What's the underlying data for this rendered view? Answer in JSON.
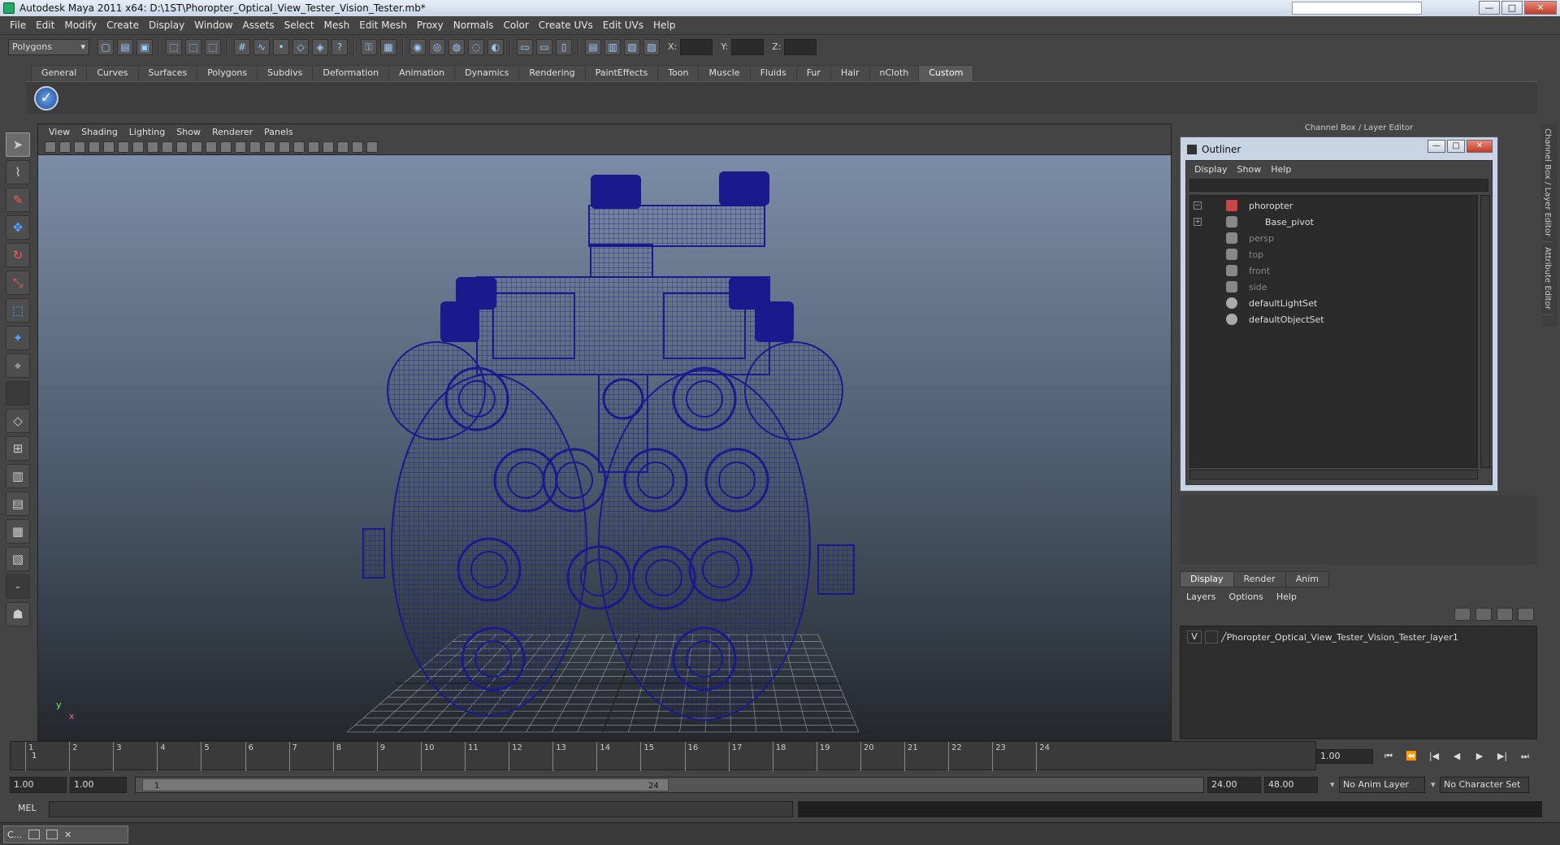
{
  "window": {
    "title": "Autodesk Maya 2011 x64: D:\\1ST\\Phoropter_Optical_View_Tester_Vision_Tester.mb*",
    "minimize": "—",
    "maximize": "□",
    "close": "✕"
  },
  "menubar": [
    "File",
    "Edit",
    "Modify",
    "Create",
    "Display",
    "Window",
    "Assets",
    "Select",
    "Mesh",
    "Edit Mesh",
    "Proxy",
    "Normals",
    "Color",
    "Create UVs",
    "Edit UVs",
    "Help"
  ],
  "statusline": {
    "mode": "Polygons",
    "x_label": "X:",
    "y_label": "Y:",
    "z_label": "Z:"
  },
  "shelf": {
    "tabs": [
      "General",
      "Curves",
      "Surfaces",
      "Polygons",
      "Subdivs",
      "Deformation",
      "Animation",
      "Dynamics",
      "Rendering",
      "PaintEffects",
      "Toon",
      "Muscle",
      "Fluids",
      "Fur",
      "Hair",
      "nCloth",
      "Custom"
    ],
    "active_tab": "Custom",
    "check_glyph": "✓"
  },
  "viewport": {
    "menu": [
      "View",
      "Shading",
      "Lighting",
      "Show",
      "Renderer",
      "Panels"
    ],
    "axis_y": "y",
    "axis_x": "x",
    "wire_color": "#1a1a8c"
  },
  "channel_box_title": "Channel Box / Layer Editor",
  "sidebar_tabs": [
    "Channel Box / Layer Editor",
    "Attribute Editor"
  ],
  "outliner": {
    "title": "Outliner",
    "menu": [
      "Display",
      "Show",
      "Help"
    ],
    "items": [
      {
        "label": "phoropter",
        "expander": "−",
        "type": "transform",
        "dim": false
      },
      {
        "label": "Base_pivot",
        "expander": "+",
        "type": "locator",
        "dim": false
      },
      {
        "label": "persp",
        "type": "camera",
        "dim": true
      },
      {
        "label": "top",
        "type": "camera",
        "dim": true
      },
      {
        "label": "front",
        "type": "camera",
        "dim": true
      },
      {
        "label": "side",
        "type": "camera",
        "dim": true
      },
      {
        "label": "defaultLightSet",
        "type": "set",
        "dim": false
      },
      {
        "label": "defaultObjectSet",
        "type": "set",
        "dim": false
      }
    ]
  },
  "layer_editor": {
    "tabs": [
      "Display",
      "Render",
      "Anim"
    ],
    "active_tab": "Display",
    "menu": [
      "Layers",
      "Options",
      "Help"
    ],
    "layer": {
      "visible": "V",
      "name": "Phoropter_Optical_View_Tester_Vision_Tester_layer1"
    }
  },
  "timeline": {
    "ticks": [
      "1",
      "2",
      "3",
      "4",
      "5",
      "6",
      "7",
      "8",
      "9",
      "10",
      "11",
      "12",
      "13",
      "14",
      "15",
      "16",
      "17",
      "18",
      "19",
      "20",
      "21",
      "22",
      "23",
      "24"
    ],
    "current_frame_marker": "1",
    "current_time": "1.00",
    "playback": [
      "⏮",
      "⏪",
      "|◀",
      "◀",
      "▶",
      "▶|",
      "⏭"
    ]
  },
  "range": {
    "start": "1.00",
    "playback_start": "1.00",
    "handle_left": "1",
    "handle_right": "24",
    "playback_end": "24.00",
    "end": "48.00",
    "anim_layer": "No Anim Layer",
    "character_set": "No Character Set"
  },
  "command_line": {
    "label": "MEL"
  },
  "taskbar": {
    "item": "C..."
  }
}
